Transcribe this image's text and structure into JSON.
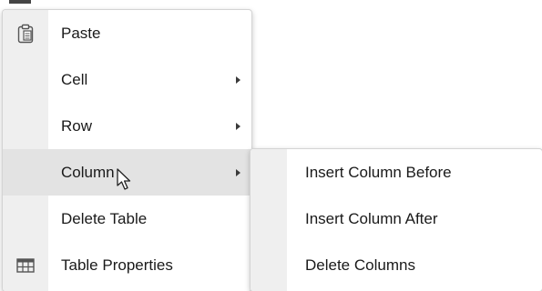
{
  "context_menu": {
    "items": [
      {
        "label": "Paste",
        "icon": "clipboard-icon",
        "has_submenu": false
      },
      {
        "label": "Cell",
        "icon": "",
        "has_submenu": true
      },
      {
        "label": "Row",
        "icon": "",
        "has_submenu": true
      },
      {
        "label": "Column",
        "icon": "",
        "has_submenu": true,
        "highlighted": true
      },
      {
        "label": "Delete Table",
        "icon": "",
        "has_submenu": false
      },
      {
        "label": "Table Properties",
        "icon": "table-icon",
        "has_submenu": false
      }
    ]
  },
  "column_submenu": {
    "items": [
      {
        "label": "Insert Column Before"
      },
      {
        "label": "Insert Column After"
      },
      {
        "label": "Delete Columns"
      }
    ]
  },
  "colors": {
    "gutter": "#efefef",
    "highlight": "#e3e3e3",
    "text": "#1a1a1a"
  }
}
